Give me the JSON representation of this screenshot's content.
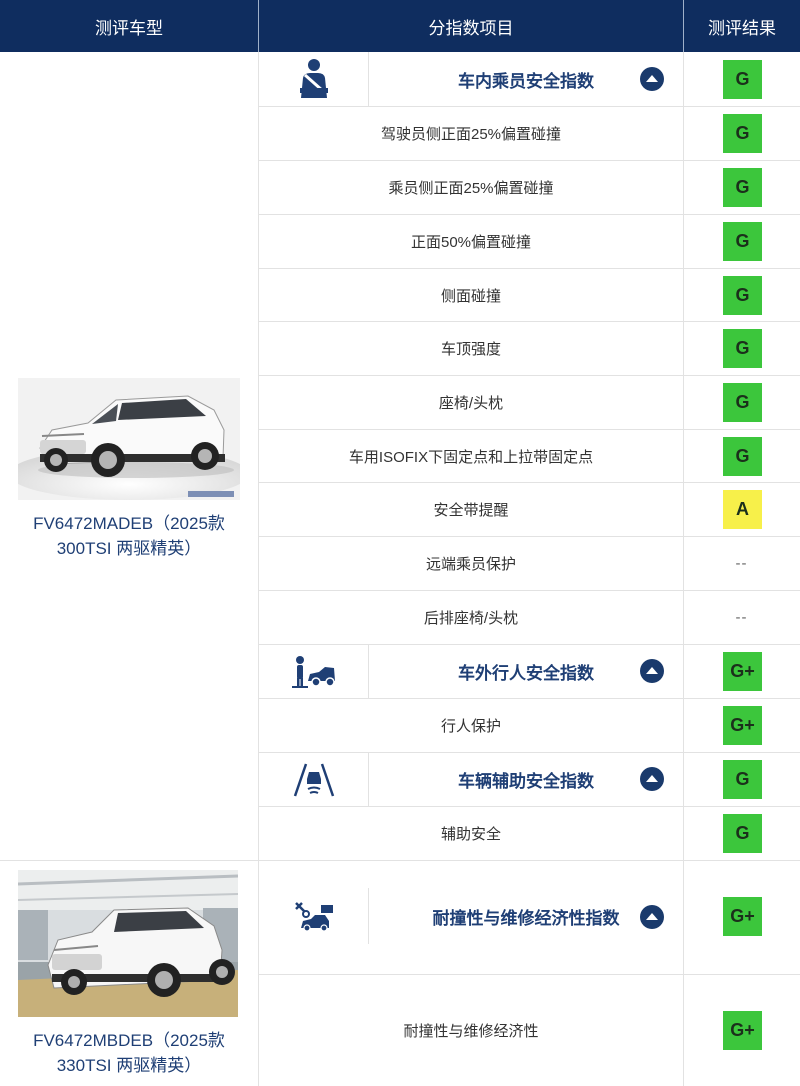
{
  "header": {
    "col_model": "测评车型",
    "col_items": "分指数项目",
    "col_result": "测评结果"
  },
  "colors": {
    "header_bg": "#0f2d5f",
    "rating_green": "#3cc63c",
    "rating_yellow": "#f7f04a",
    "title_blue": "#1f3f75"
  },
  "models": [
    {
      "name_line1": "FV6472MADEB（2025款",
      "name_line2": "300TSI 两驱精英）",
      "image": "white-suv-photo-studio"
    },
    {
      "name_line1": "FV6472MBDEB（2025款",
      "name_line2": "330TSI 两驱精英）",
      "image": "white-suv-photo-factory"
    }
  ],
  "rows": [
    {
      "type": "category",
      "icon": "seatbelt-occupant-icon",
      "label": "车内乘员安全指数",
      "rating": "G"
    },
    {
      "type": "item",
      "label": "驾驶员侧正面25%偏置碰撞",
      "rating": "G"
    },
    {
      "type": "item",
      "label": "乘员侧正面25%偏置碰撞",
      "rating": "G"
    },
    {
      "type": "item",
      "label": "正面50%偏置碰撞",
      "rating": "G"
    },
    {
      "type": "item",
      "label": "侧面碰撞",
      "rating": "G"
    },
    {
      "type": "item",
      "label": "车顶强度",
      "rating": "G"
    },
    {
      "type": "item",
      "label": "座椅/头枕",
      "rating": "G"
    },
    {
      "type": "item",
      "label": "车用ISOFIX下固定点和上拉带固定点",
      "rating": "G"
    },
    {
      "type": "item",
      "label": "安全带提醒",
      "rating": "A"
    },
    {
      "type": "item",
      "label": "远端乘员保护",
      "rating": "--"
    },
    {
      "type": "item",
      "label": "后排座椅/头枕",
      "rating": "--"
    },
    {
      "type": "category",
      "icon": "pedestrian-car-icon",
      "label": "车外行人安全指数",
      "rating": "G+"
    },
    {
      "type": "item",
      "label": "行人保护",
      "rating": "G+"
    },
    {
      "type": "category",
      "icon": "lane-assist-icon",
      "label": "车辆辅助安全指数",
      "rating": "G"
    },
    {
      "type": "item",
      "label": "辅助安全",
      "rating": "G"
    },
    {
      "type": "category",
      "icon": "repair-tools-icon",
      "label": "耐撞性与维修经济性指数",
      "rating": "G+"
    },
    {
      "type": "item",
      "label": "耐撞性与维修经济性",
      "rating": "G+"
    }
  ]
}
